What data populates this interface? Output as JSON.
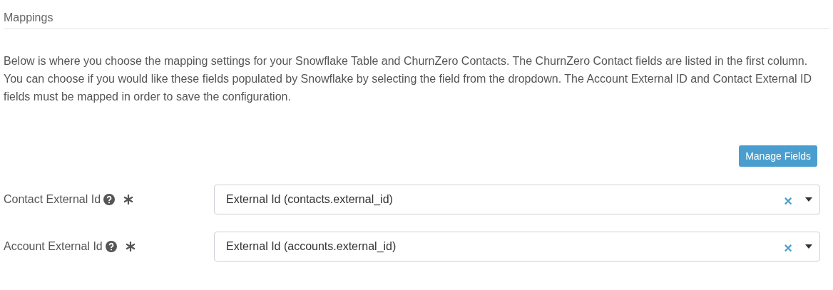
{
  "section": {
    "title": "Mappings"
  },
  "description": "Below is where you choose the mapping settings for your Snowflake Table and ChurnZero Contacts. The ChurnZero Contact fields are listed in the first column. You can choose if you would like these fields populated by Snowflake by selecting the field from the dropdown. The Account External ID and Contact External ID fields must be mapped in order to save the configuration.",
  "manage_button": "Manage Fields",
  "mappings": [
    {
      "label": "Contact External Id",
      "required": true,
      "value": "External Id (contacts.external_id)",
      "clear": "×"
    },
    {
      "label": "Account External Id",
      "required": true,
      "value": "External Id (accounts.external_id)",
      "clear": "×"
    }
  ]
}
